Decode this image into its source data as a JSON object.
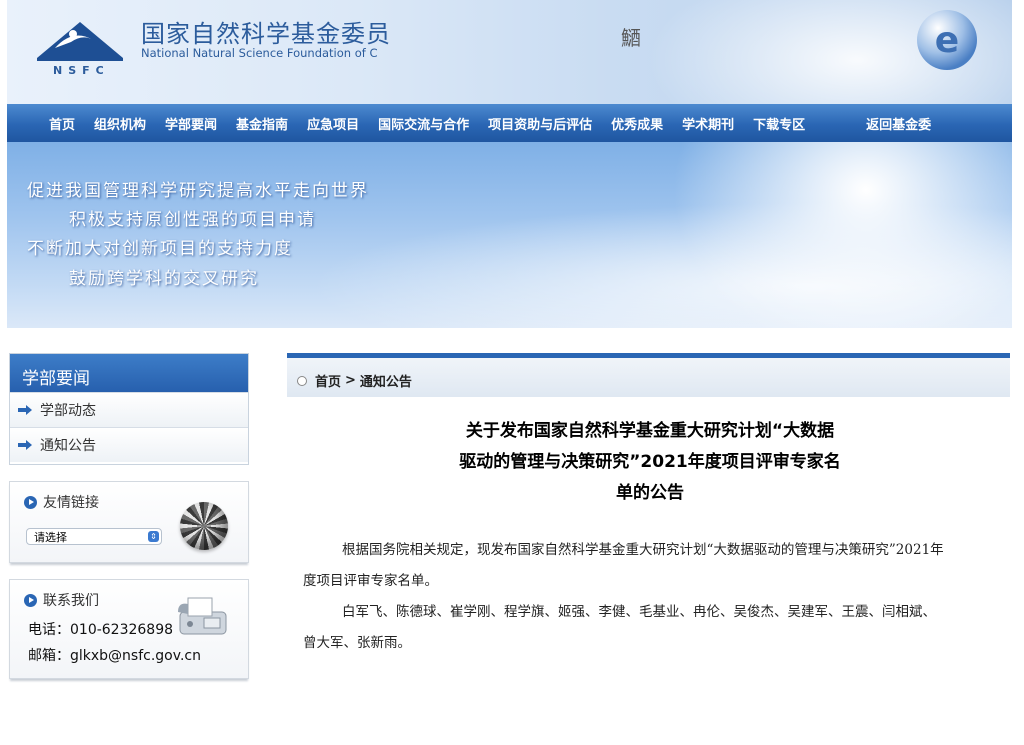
{
  "header": {
    "title": "国家自然科学基金委员",
    "subtitle": "National Natural Science Foundation of C",
    "abbr": "NSFC",
    "glyph": "鿐"
  },
  "nav": {
    "items": [
      {
        "label": "首页"
      },
      {
        "label": "组织机构"
      },
      {
        "label": "学部要闻"
      },
      {
        "label": "基金指南"
      },
      {
        "label": "应急项目"
      },
      {
        "label": "国际交流与合作"
      },
      {
        "label": "项目资助与后评估"
      },
      {
        "label": "优秀成果"
      },
      {
        "label": "学术期刊"
      },
      {
        "label": "下载专区"
      },
      {
        "label": "返回基金委"
      }
    ]
  },
  "banner": {
    "lines": [
      "促进我国管理科学研究提高水平走向世界",
      "积极支持原创性强的项目申请",
      "不断加大对创新项目的支持力度",
      "鼓励跨学科的交叉研究"
    ]
  },
  "sidebar": {
    "section_title": "学部要闻",
    "items": [
      {
        "label": "学部动态"
      },
      {
        "label": "通知公告"
      }
    ],
    "links_box": {
      "title": "友情链接",
      "select_value": "请选择"
    },
    "contact_box": {
      "title": "联系我们",
      "phone": "电话：010-62326898",
      "email": "邮箱：glkxb@nsfc.gov.cn"
    }
  },
  "breadcrumb": {
    "home": "首页",
    "separator": ">",
    "current": "通知公告"
  },
  "article": {
    "title_lines": [
      "关于发布国家自然科学基金重大研究计划“大数据",
      "驱动的管理与决策研究”2021年度项目评审专家名",
      "单的公告"
    ],
    "paragraph1_line1": "根据国务院相关规定，现发布国家自然科学基金重大研究计划“大数据驱动的管理与决策研究”2021年",
    "paragraph1_line2": "度项目评审专家名单。",
    "paragraph2_line1": "白军飞、陈德球、崔学刚、程学旗、姬强、李健、毛基业、冉伦、吴俊杰、吴建军、王震、闫相斌、",
    "paragraph2_line2": "曾大军、张新雨。"
  }
}
